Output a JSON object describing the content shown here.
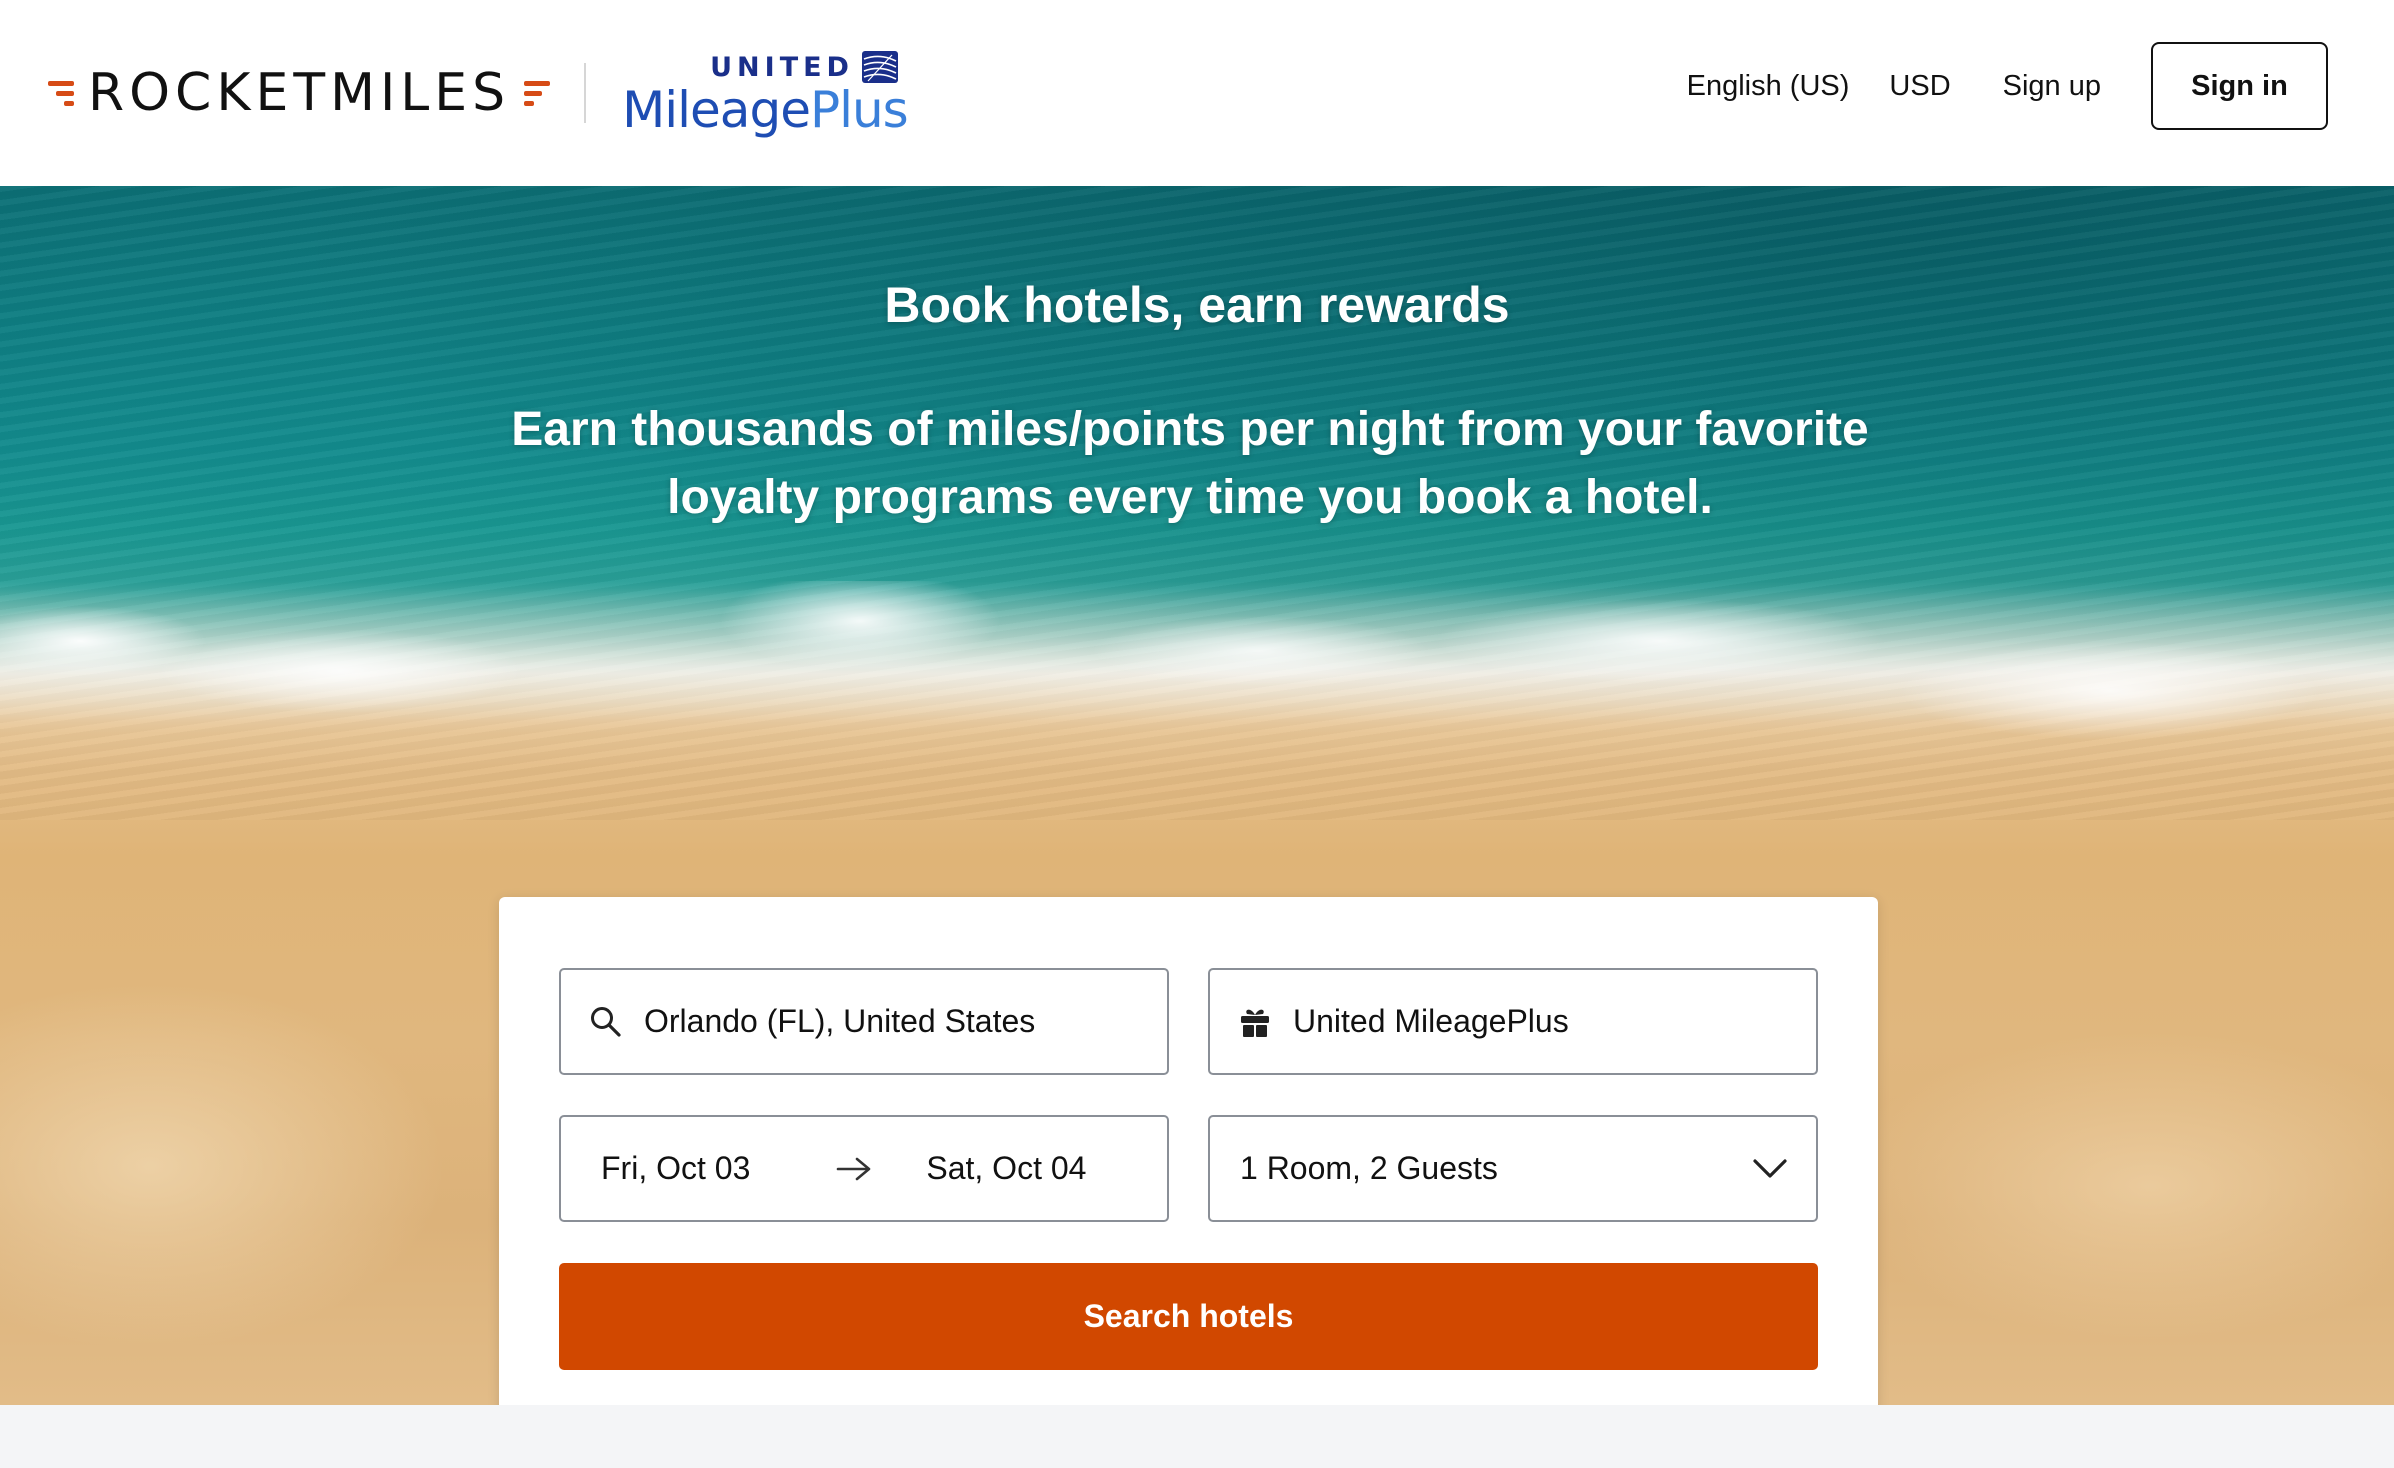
{
  "brand": {
    "rocketmiles": "ROCKETMILES",
    "partner_top": "UNITED",
    "partner_main": "Mileage",
    "partner_plus": "Plus",
    "accent_color": "#d14800",
    "partner_color": "#1e4db3"
  },
  "nav": {
    "language": "English (US)",
    "currency": "USD",
    "signup": "Sign up",
    "signin": "Sign in"
  },
  "hero": {
    "title": "Book hotels, earn rewards",
    "subtitle": "Earn thousands of miles/points per night from your favorite loyalty programs every time you book a hotel."
  },
  "search": {
    "destination": "Orlando (FL), United States",
    "program": "United MileagePlus",
    "checkin": "Fri, Oct 03",
    "checkout": "Sat, Oct 04",
    "guests": "1 Room, 2 Guests",
    "submit": "Search hotels",
    "icons": {
      "destination": "search-icon",
      "program": "gift-icon",
      "dates": "arrow-right-icon",
      "guests": "chevron-down-icon"
    }
  }
}
